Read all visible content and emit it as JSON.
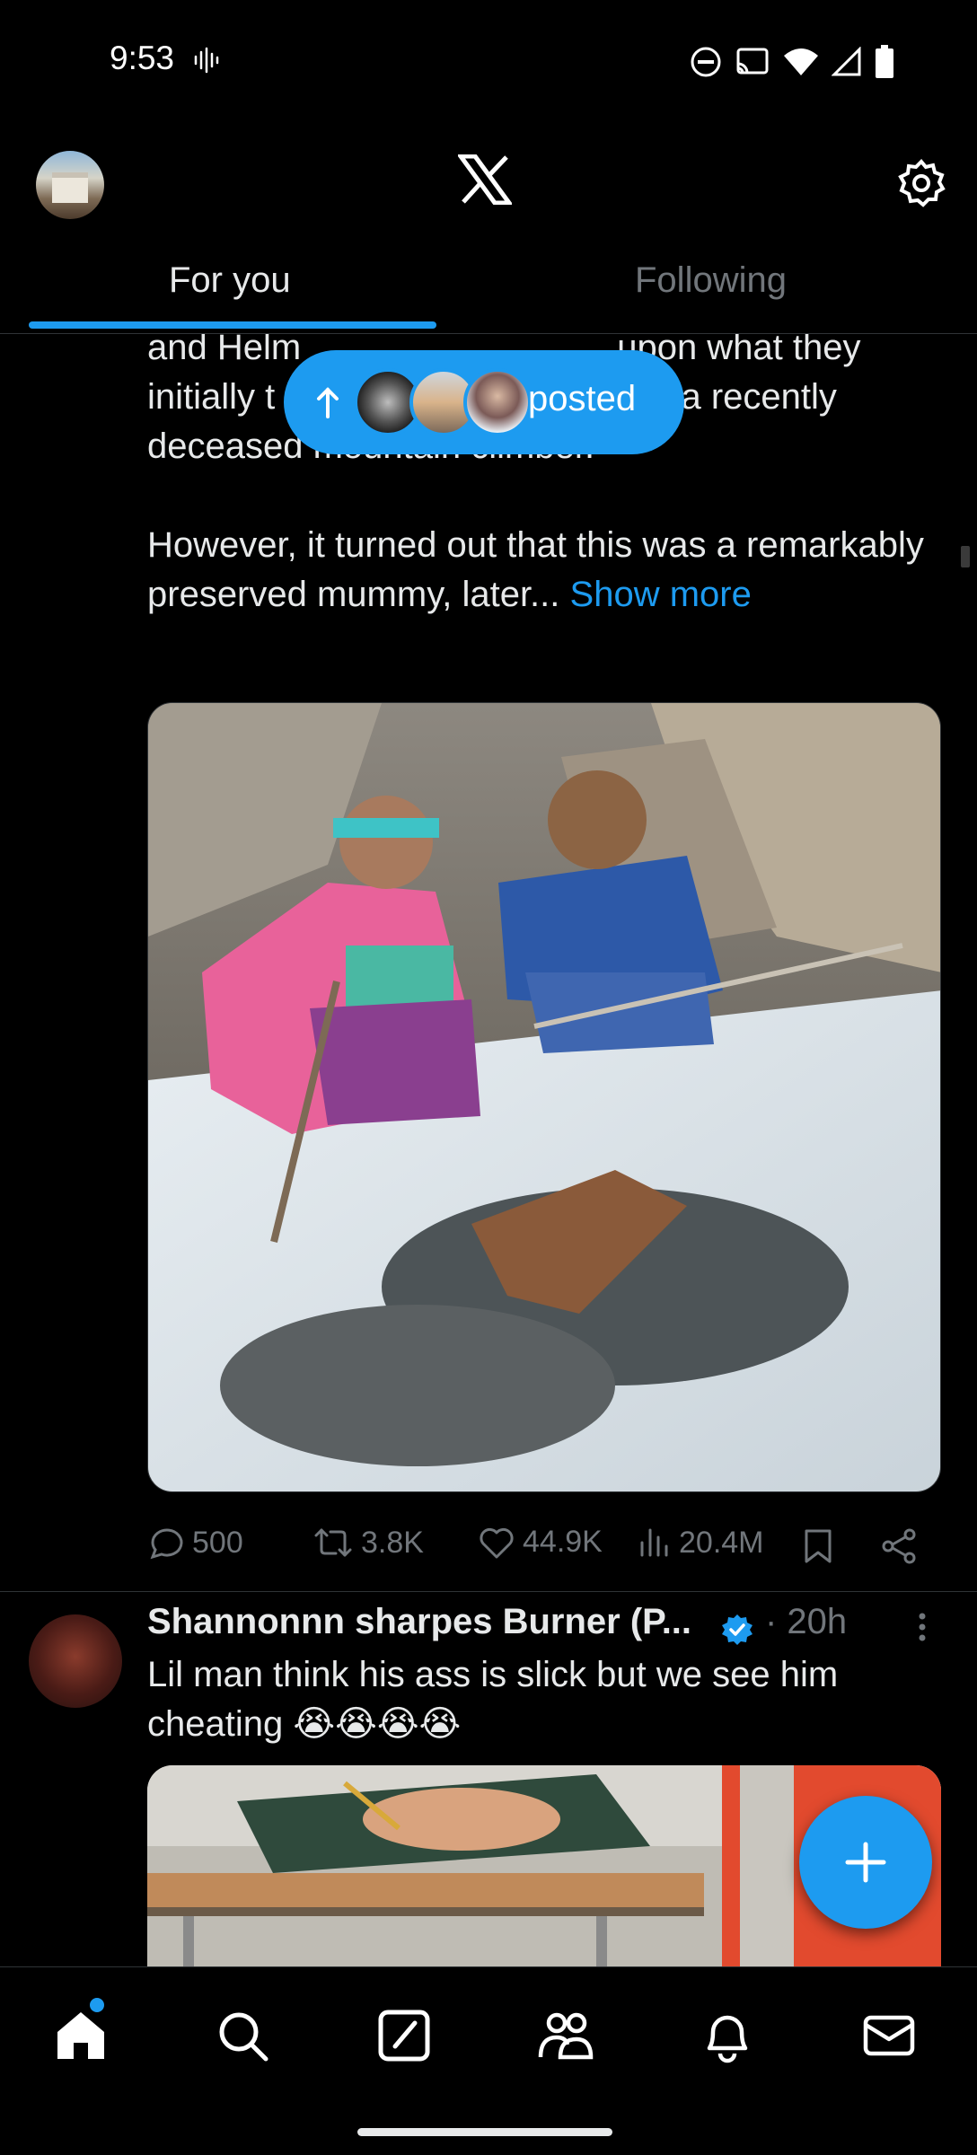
{
  "status_bar": {
    "time": "9:53"
  },
  "header": {
    "logo_icon": "x-logo-icon",
    "settings_icon": "gear-icon"
  },
  "tabs": [
    {
      "label": "For you",
      "active": true
    },
    {
      "label": "Following",
      "active": false
    }
  ],
  "new_posts_pill": {
    "label": "posted"
  },
  "post1": {
    "text_lines": [
      "and Helm",
      "upon what they",
      "initially t",
      "f a recently",
      "deceased mountain climber."
    ],
    "paragraph2": "However, it turned out that this was a remarkably preserved mummy, later...",
    "show_more": "Show more",
    "stats": {
      "replies": "500",
      "reposts": "3.8K",
      "likes": "44.9K",
      "views": "20.4M"
    }
  },
  "post2": {
    "author": "Shannonnn sharpes Burner (P...",
    "verified": true,
    "time": "· 20h",
    "text": "Lil man think his ass is slick but we see him cheating 😭😭😭😭"
  },
  "bottom_nav": [
    {
      "icon": "home-icon",
      "active": true,
      "badge": true
    },
    {
      "icon": "search-icon"
    },
    {
      "icon": "grok-icon"
    },
    {
      "icon": "communities-icon"
    },
    {
      "icon": "notifications-icon"
    },
    {
      "icon": "messages-icon"
    }
  ],
  "colors": {
    "accent": "#1d9bf0",
    "background": "#000000",
    "text_primary": "#e7e9ea",
    "text_secondary": "#71767b"
  }
}
